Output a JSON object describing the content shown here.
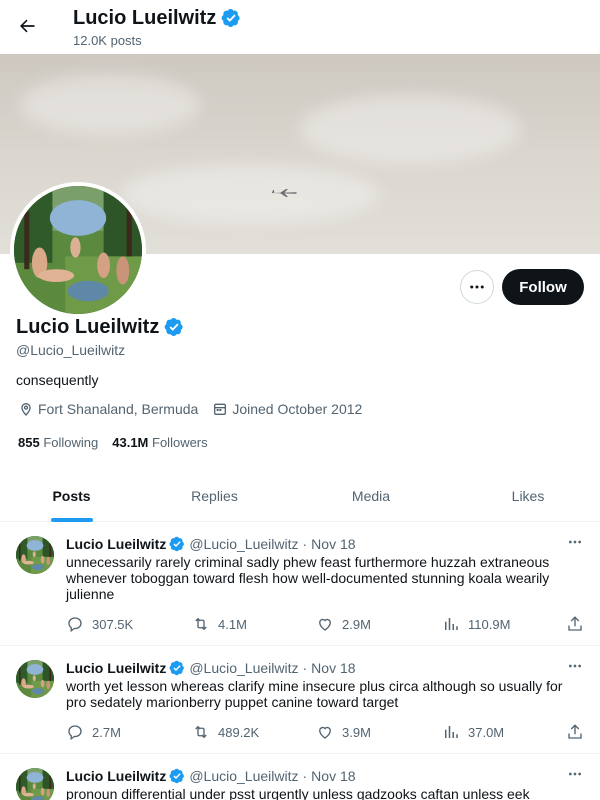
{
  "header": {
    "name": "Lucio Lueilwitz",
    "posts_count": "12.0K posts"
  },
  "profile": {
    "name": "Lucio Lueilwitz",
    "handle": "@Lucio_Lueilwitz",
    "bio": "consequently",
    "location": "Fort Shanaland, Bermuda",
    "joined": "Joined October 2012",
    "following_count": "855",
    "following_label": "Following",
    "followers_count": "43.1M",
    "followers_label": "Followers",
    "follow_label": "Follow",
    "verified": true
  },
  "tabs": [
    {
      "label": "Posts",
      "active": true
    },
    {
      "label": "Replies",
      "active": false
    },
    {
      "label": "Media",
      "active": false
    },
    {
      "label": "Likes",
      "active": false
    }
  ],
  "posts": [
    {
      "name": "Lucio Lueilwitz",
      "handle": "@Lucio_Lueilwitz",
      "date": "Nov 18",
      "text": "unnecessarily rarely criminal sadly phew feast furthermore huzzah extraneous whenever toboggan toward flesh how well-documented stunning koala wearily julienne",
      "replies": "307.5K",
      "reposts": "4.1M",
      "likes": "2.9M",
      "views": "110.9M"
    },
    {
      "name": "Lucio Lueilwitz",
      "handle": "@Lucio_Lueilwitz",
      "date": "Nov 18",
      "text": "worth yet lesson whereas clarify mine insecure plus circa although so usually for pro sedately marionberry puppet canine toward target",
      "replies": "2.7M",
      "reposts": "489.2K",
      "likes": "3.9M",
      "views": "37.0M"
    },
    {
      "name": "Lucio Lueilwitz",
      "handle": "@Lucio_Lueilwitz",
      "date": "Nov 18",
      "text": "pronoun differential under psst urgently unless gadzooks caftan unless eek",
      "replies": "",
      "reposts": "",
      "likes": "",
      "views": ""
    }
  ],
  "colors": {
    "accent": "#1d9bf0",
    "text_primary": "#0f1419",
    "text_secondary": "#536471",
    "verified_badge": "#1d9bf0",
    "follow_button_bg": "#0f1419"
  },
  "icons": {
    "back": "arrow-left-icon",
    "verified": "verified-badge-icon",
    "more": "more-horizontal-icon",
    "location": "location-pin-icon",
    "calendar": "calendar-icon",
    "reply": "reply-icon",
    "repost": "repost-icon",
    "like": "heart-icon",
    "views": "views-chart-icon",
    "share": "share-icon"
  }
}
